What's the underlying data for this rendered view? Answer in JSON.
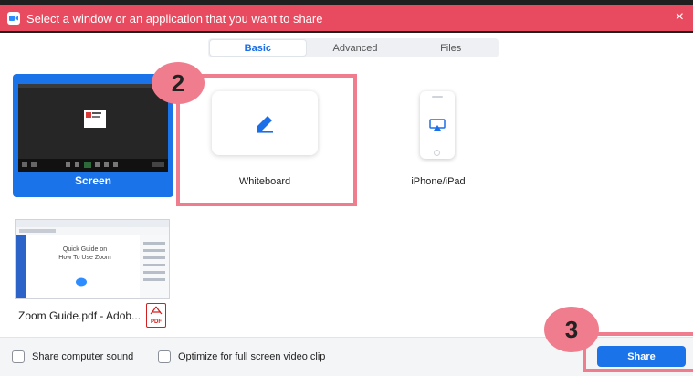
{
  "colors": {
    "title_bar": "#e84a5f",
    "accent": "#1a73e8",
    "annotation": "#f07d8d"
  },
  "window": {
    "title": "Select a window or an application that you want to share",
    "close_icon": "×"
  },
  "tabs": [
    {
      "label": "Basic",
      "active": true
    },
    {
      "label": "Advanced",
      "active": false
    },
    {
      "label": "Files",
      "active": false
    }
  ],
  "tiles": {
    "screen": {
      "label": "Screen",
      "selected": true
    },
    "whiteboard": {
      "label": "Whiteboard"
    },
    "iphone": {
      "label": "iPhone/iPad"
    },
    "pdf": {
      "label": "Zoom Guide.pdf - Adob...",
      "preview_text": "Quick Guide on\nHow To Use Zoom",
      "file_badge": "PDF"
    }
  },
  "annotations": {
    "step2": "2",
    "step3": "3"
  },
  "footer": {
    "share_sound": {
      "label": "Share computer sound",
      "checked": false
    },
    "optimize_video": {
      "label": "Optimize for full screen video clip",
      "checked": false
    },
    "share_button": "Share"
  }
}
